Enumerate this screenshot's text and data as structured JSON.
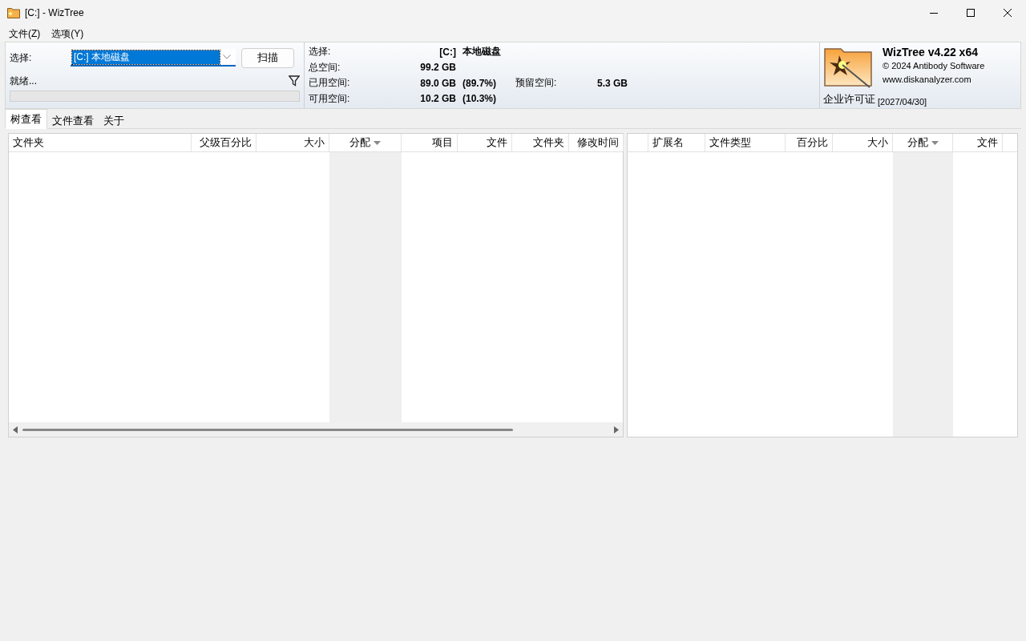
{
  "window": {
    "title": "[C:]  - WizTree"
  },
  "menu": [
    "文件(Z)",
    "选项(Y)"
  ],
  "scan_panel": {
    "select_label": "选择:",
    "drive": "[C:] 本地磁盘",
    "scan_button": "扫描",
    "status": "就绪...",
    "progress": {
      "level": 0
    }
  },
  "drive_info": {
    "select_label": "选择:",
    "drive_letter": "[C:]",
    "drive_name": "本地磁盘",
    "rows": [
      {
        "label": "总空间:",
        "value": "99.2 GB"
      },
      {
        "label": "已用空间:",
        "value": "89.0 GB",
        "percent": "(89.7%)",
        "extra_label": "预留空间:",
        "extra_value": "5.3 GB"
      },
      {
        "label": "可用空间:",
        "value": "10.2 GB",
        "percent": "(10.3%)"
      }
    ]
  },
  "about": {
    "title": "WizTree v4.22 x64",
    "copyright": "© 2024 Antibody Software",
    "website": "www.diskanalyzer.com",
    "license": "企业许可证",
    "license_date": "[2027/04/30]"
  },
  "tabs": [
    {
      "label": "树查看",
      "selected": true
    },
    {
      "label": "文件查看",
      "selected": false
    },
    {
      "label": "关于",
      "selected": false
    }
  ],
  "tree_table": {
    "columns": [
      {
        "label": "文件夹",
        "sorted": false
      },
      {
        "label": "父级百分比",
        "sorted": false
      },
      {
        "label": "大小",
        "sorted": false
      },
      {
        "label": "分配",
        "sorted": true
      },
      {
        "label": "项目",
        "sorted": false
      },
      {
        "label": "文件",
        "sorted": false
      },
      {
        "label": "文件夹",
        "sorted": false
      },
      {
        "label": "修改时间",
        "sorted": false
      }
    ]
  },
  "type_table": {
    "columns": [
      {
        "label": "扩展名",
        "sorted": false
      },
      {
        "label": "文件类型",
        "sorted": false
      },
      {
        "label": "百分比",
        "sorted": false
      },
      {
        "label": "大小",
        "sorted": false
      },
      {
        "label": "分配",
        "sorted": true
      },
      {
        "label": "文件",
        "sorted": false
      }
    ]
  }
}
